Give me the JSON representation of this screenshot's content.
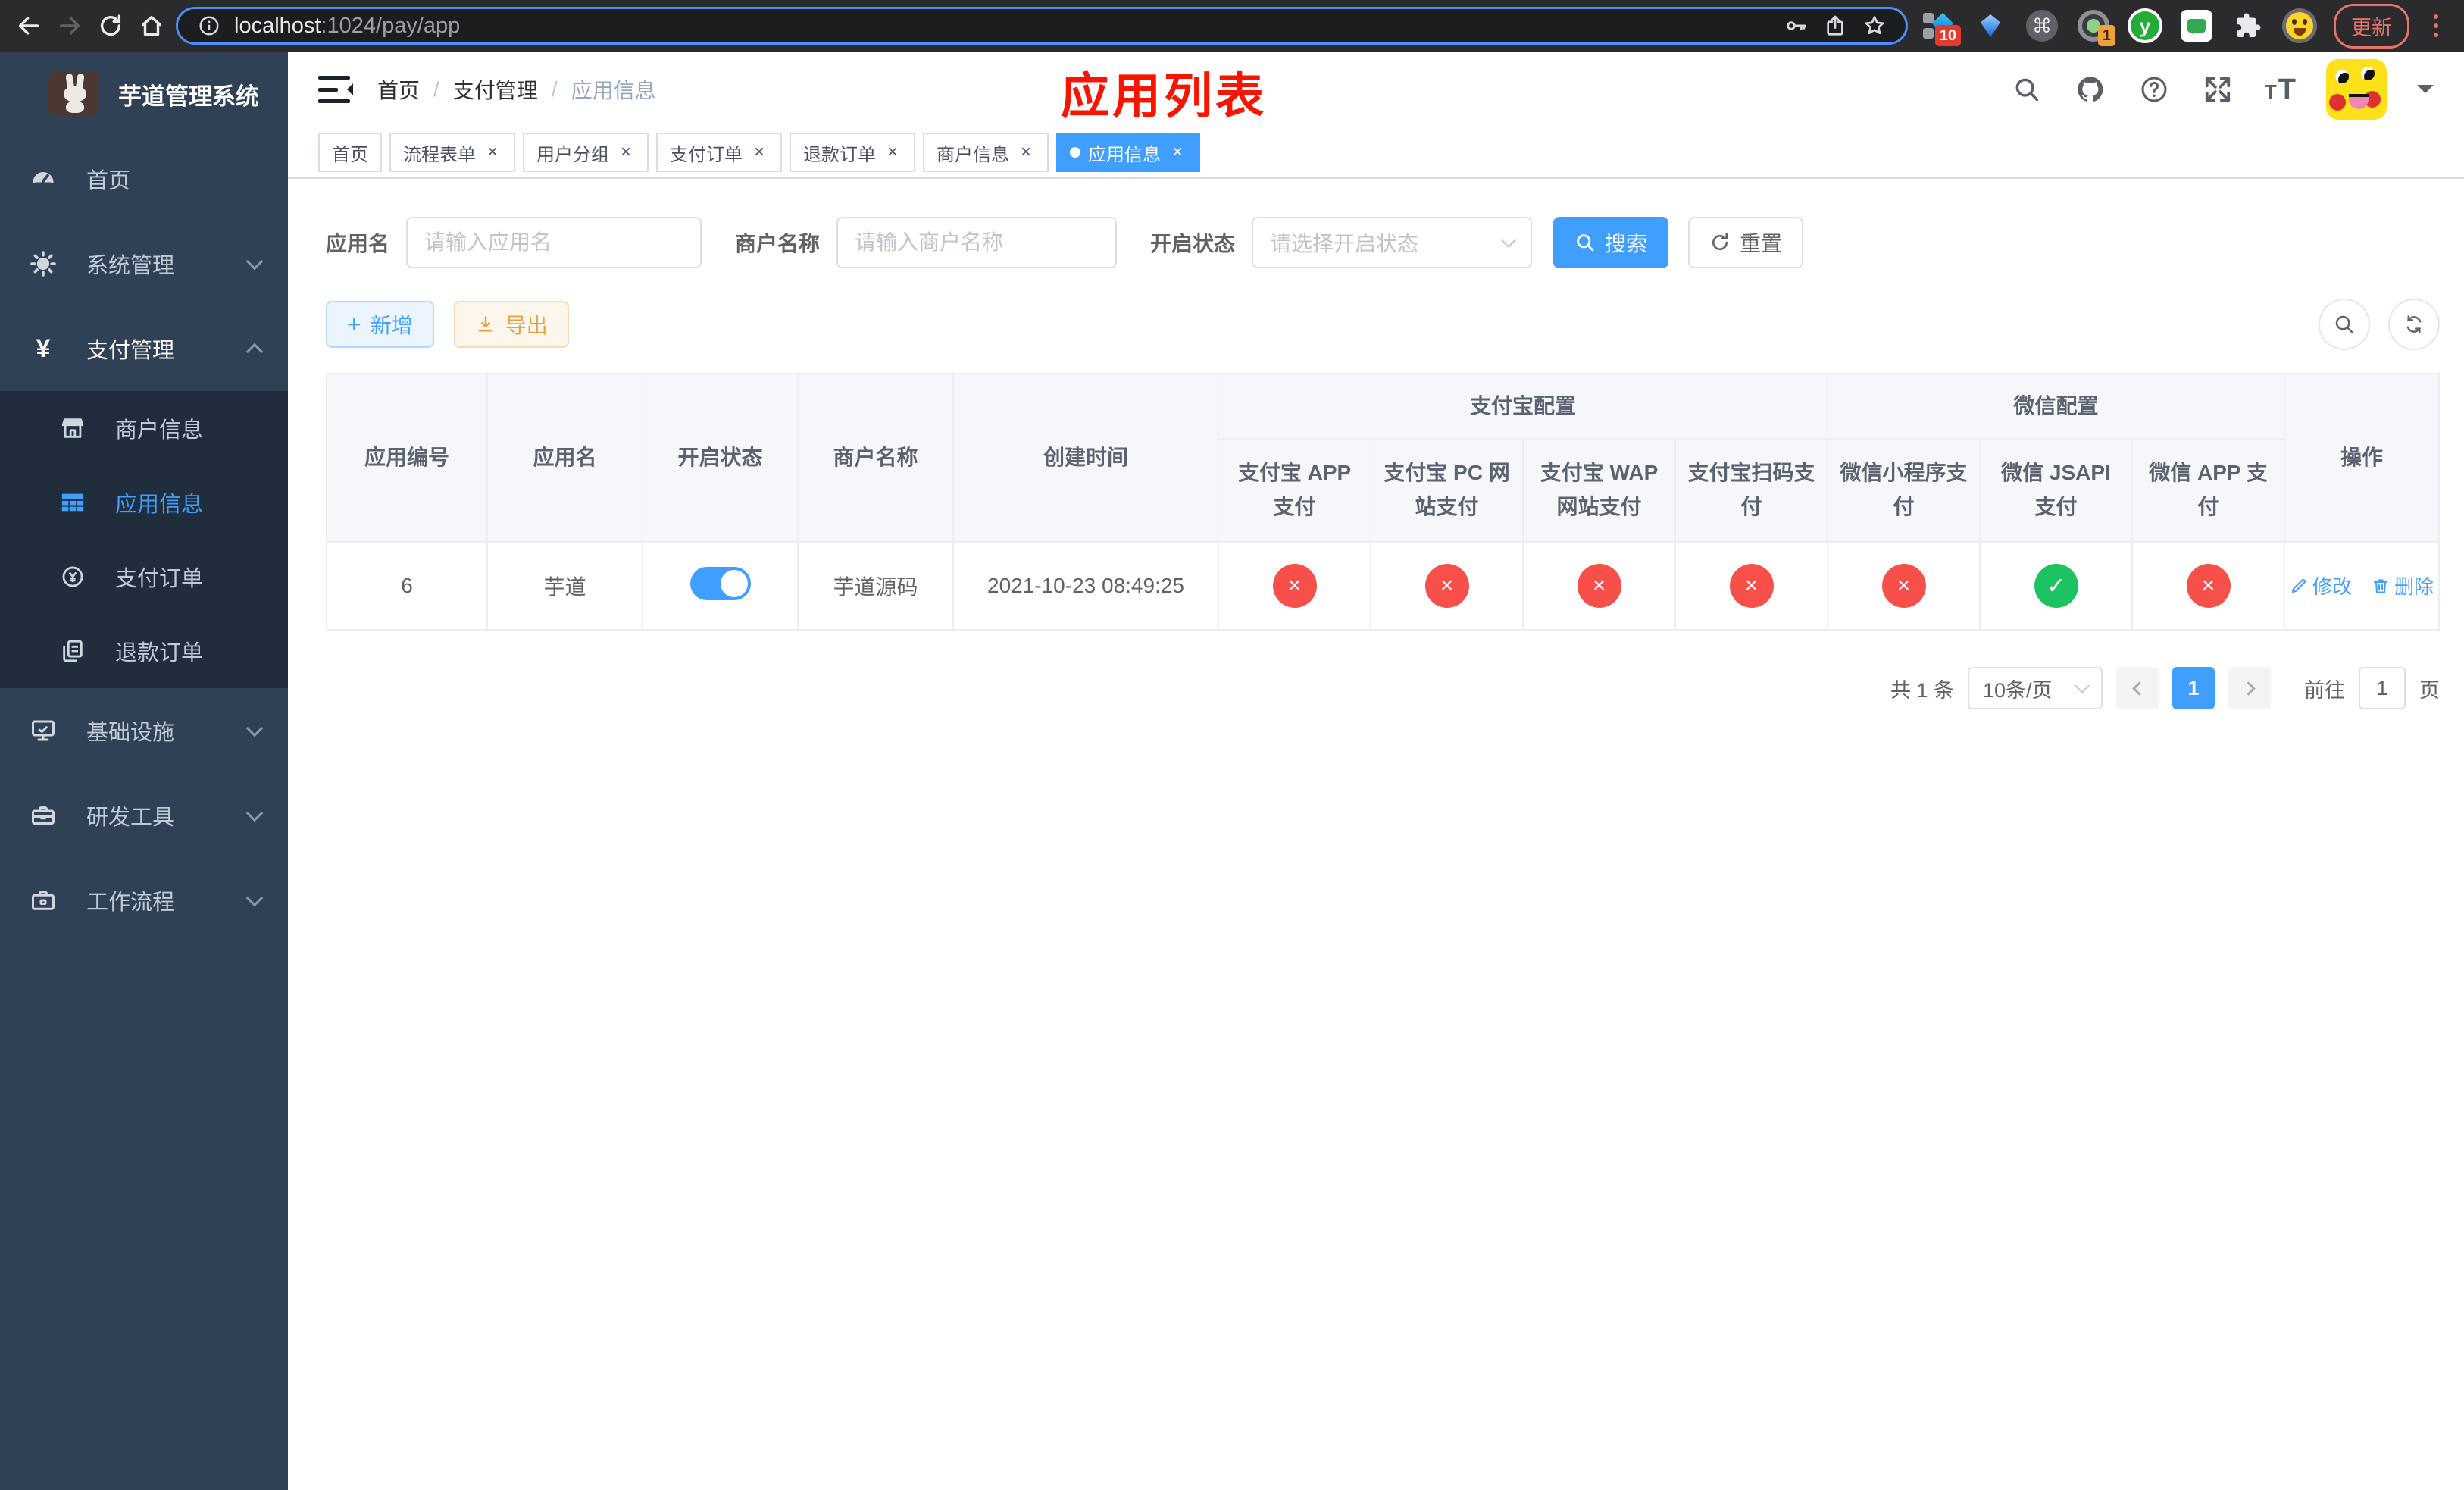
{
  "browser": {
    "url": {
      "host": "localhost",
      "rest": ":1024/pay/app"
    },
    "ext_badge_shortcut": "10",
    "ext_badge_recorder": "1",
    "ext_letter_y": "y",
    "cmd_glyph": "⌘",
    "update_label": "更新"
  },
  "sidebar": {
    "title": "芋道管理系统",
    "items": [
      {
        "label": "首页"
      },
      {
        "label": "系统管理"
      },
      {
        "label": "支付管理"
      },
      {
        "label": "基础设施"
      },
      {
        "label": "研发工具"
      },
      {
        "label": "工作流程"
      }
    ],
    "pay_children": [
      {
        "label": "商户信息"
      },
      {
        "label": "应用信息"
      },
      {
        "label": "支付订单"
      },
      {
        "label": "退款订单"
      }
    ],
    "yen_glyph": "¥"
  },
  "header": {
    "breadcrumb": [
      "首页",
      "支付管理",
      "应用信息"
    ],
    "separator": "/",
    "annotation": "应用列表",
    "font_icon_small": "T",
    "font_icon_large": "T"
  },
  "tabs": {
    "close_glyph": "×",
    "items": [
      {
        "label": "首页"
      },
      {
        "label": "流程表单"
      },
      {
        "label": "用户分组"
      },
      {
        "label": "支付订单"
      },
      {
        "label": "退款订单"
      },
      {
        "label": "商户信息"
      },
      {
        "label": "应用信息"
      }
    ]
  },
  "filters": {
    "app_name": {
      "label": "应用名",
      "placeholder": "请输入应用名"
    },
    "merchant": {
      "label": "商户名称",
      "placeholder": "请输入商户名称"
    },
    "status": {
      "label": "开启状态",
      "placeholder": "请选择开启状态"
    },
    "search_label": "搜索",
    "reset_label": "重置"
  },
  "toolbar": {
    "add_label": "新增",
    "add_plus": "+",
    "export_label": "导出"
  },
  "table": {
    "columns": [
      "应用编号",
      "应用名",
      "开启状态",
      "商户名称",
      "创建时间"
    ],
    "group_alipay": "支付宝配置",
    "group_wechat": "微信配置",
    "alipay_cols": [
      "支付宝 APP 支付",
      "支付宝 PC 网站支付",
      "支付宝 WAP 网站支付",
      "支付宝扫码支付"
    ],
    "wechat_cols": [
      "微信小程序支付",
      "微信 JSAPI 支付",
      "微信 APP 支付"
    ],
    "ops_col": "操作",
    "row": {
      "id": "6",
      "name": "芋道",
      "merchant": "芋道源码",
      "created": "2021-10-23 08:49:25",
      "statuses": [
        "×",
        "×",
        "×",
        "×",
        "×",
        "✓",
        "×"
      ],
      "edit_label": "修改",
      "delete_label": "删除"
    }
  },
  "pagination": {
    "total": "共 1 条",
    "size": "10条/页",
    "page": "1",
    "goto_prefix": "前往",
    "goto_value": "1",
    "goto_suffix": "页"
  },
  "colors": {
    "primary": "#409eff",
    "sidebar_bg": "#304156",
    "submenu_bg": "#1f2d3d",
    "danger_circle": "#f7504b",
    "success_circle": "#1dc261",
    "annotation_red": "#f81400"
  }
}
